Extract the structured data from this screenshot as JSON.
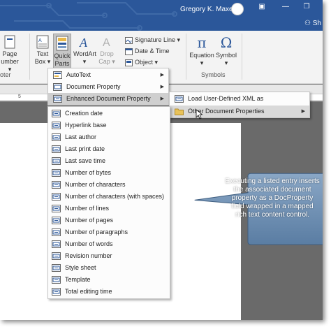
{
  "titlebar": {
    "user_name": "Gregory K. Maxey",
    "share_label": "Sh"
  },
  "ribbon": {
    "page_number": {
      "line1": "Page",
      "line2": "umber"
    },
    "text_box": {
      "line1": "Text",
      "line2": "Box"
    },
    "quick_parts": {
      "line1": "Quick",
      "line2": "Parts"
    },
    "wordart": {
      "line1": "WordArt"
    },
    "drop_cap": {
      "line1": "Drop",
      "line2": "Cap"
    },
    "signature_line": "Signature Line",
    "date_time": "Date & Time",
    "object": "Object",
    "equation": "Equation",
    "symbol": "Symbol",
    "group_header_footer": "oter",
    "group_symbols": "Symbols"
  },
  "ruler": {
    "mark": "5"
  },
  "quick_parts_menu": [
    {
      "label": "AutoText",
      "icon": "autotext-icon",
      "has_submenu": true
    },
    {
      "label": "Document Property",
      "icon": "document-property-icon",
      "has_submenu": true
    },
    {
      "label": "Enhanced Document Property",
      "icon": "enhanced-property-icon",
      "has_submenu": true
    }
  ],
  "enhanced_submenu": [
    {
      "label": "Load User-Defined XML as CustomXMLPart",
      "icon": "load-xml-icon"
    },
    {
      "label": "Other Document Properties",
      "icon": "folder-icon",
      "has_submenu": true
    }
  ],
  "properties_list": [
    "Creation date",
    "Hyperlink base",
    "Last author",
    "Last print date",
    "Last save time",
    "Number of bytes",
    "Number of characters",
    "Number of characters (with spaces)",
    "Number of lines",
    "Number of pages",
    "Number of paragraphs",
    "Number of words",
    "Revision number",
    "Style sheet",
    "Template",
    "Total editing time"
  ],
  "callout": {
    "text": "Executing a listed entry inserts the associated document property as a DocProperty field wrapped in a mapped rich text content control."
  },
  "colors": {
    "titlebar": "#2b579a",
    "callout_fill": "#6d8fb3",
    "doc_background": "#6a6a6a"
  }
}
